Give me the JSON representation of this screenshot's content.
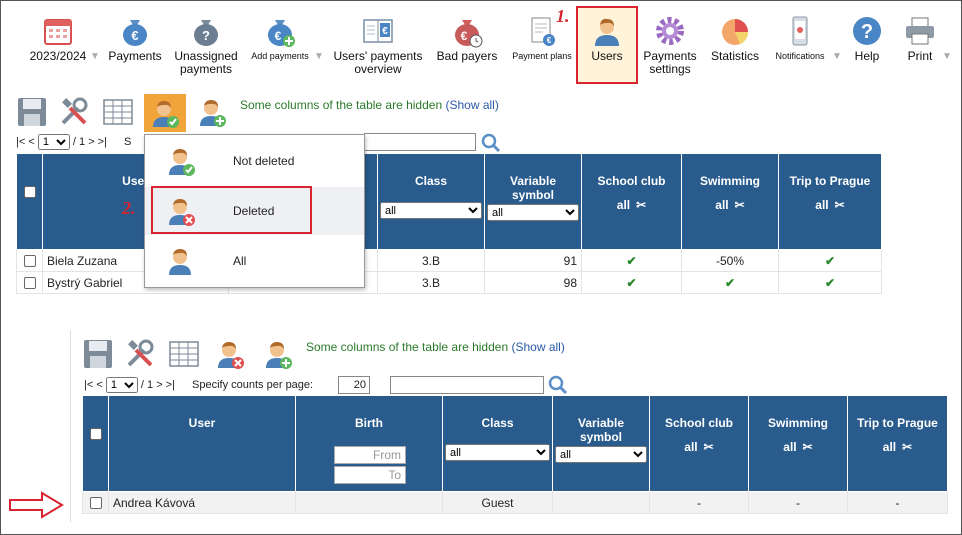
{
  "toolbar": {
    "items": [
      {
        "label": "2023/2024",
        "icon": "calendar-icon"
      },
      {
        "label": "Payments",
        "icon": "money-bag-euro-icon"
      },
      {
        "label": "Unassigned payments",
        "icon": "money-bag-question-icon"
      },
      {
        "label": "Add payments",
        "icon": "money-bag-add-icon"
      },
      {
        "label": "Users' payments overview",
        "icon": "ledger-euro-icon"
      },
      {
        "label": "Bad payers",
        "icon": "money-bag-clock-icon"
      },
      {
        "label": "Payment plans",
        "icon": "document-euro-icon"
      },
      {
        "label": "Users",
        "icon": "user-icon"
      },
      {
        "label": "Payments settings",
        "icon": "gear-icon"
      },
      {
        "label": "Statistics",
        "icon": "pie-chart-icon"
      },
      {
        "label": "Notifications",
        "icon": "phone-icon"
      },
      {
        "label": "Help",
        "icon": "help-icon"
      },
      {
        "label": "Print",
        "icon": "printer-icon"
      }
    ],
    "step1": "1.",
    "step2": "2."
  },
  "colors": {
    "header_bg": "#295b8c",
    "highlight": "#d9232e",
    "users_bg": "#fff3da",
    "note_green": "#2a7a2a"
  },
  "top_panel": {
    "hidden_note": "Some columns of the table are hidden",
    "show_all": "(Show all)",
    "pager_prev": "|< <",
    "page": "1",
    "of_pages": "/ 1",
    "pager_next": "> >|",
    "specify_partial": "S",
    "columns": [
      "User",
      "Class",
      "Variable symbol",
      "School club",
      "Swimming",
      "Trip to Prague"
    ],
    "filter_all": "all",
    "rows": [
      {
        "user": "Biela Zuzana",
        "class": "3.B",
        "vs": "91",
        "club": "✔",
        "swim": "-50%",
        "trip": "✔"
      },
      {
        "user": "Bystrý Gabriel",
        "class": "3.B",
        "vs": "98",
        "club": "✔",
        "swim": "✔",
        "trip": "✔"
      }
    ]
  },
  "menu": {
    "items": [
      {
        "label": "Not deleted"
      },
      {
        "label": "Deleted"
      },
      {
        "label": "All"
      }
    ]
  },
  "bottom_panel": {
    "hidden_note": "Some columns of the table are hidden",
    "show_all": "(Show all)",
    "pager_prev": "|< <",
    "page": "1",
    "of_pages": "/ 1",
    "pager_next": "> >|",
    "counts_label": "Specify counts per page:",
    "counts_value": "20",
    "columns": [
      "User",
      "Birth",
      "Class",
      "Variable symbol",
      "School club",
      "Swimming",
      "Trip to Prague"
    ],
    "birth_from": "From",
    "birth_to": "To",
    "filter_all": "all",
    "rows": [
      {
        "user": "Andrea Kávová",
        "birth": "",
        "class": "Guest",
        "vs": "",
        "club": "-",
        "swim": "-",
        "trip": "-"
      }
    ]
  }
}
